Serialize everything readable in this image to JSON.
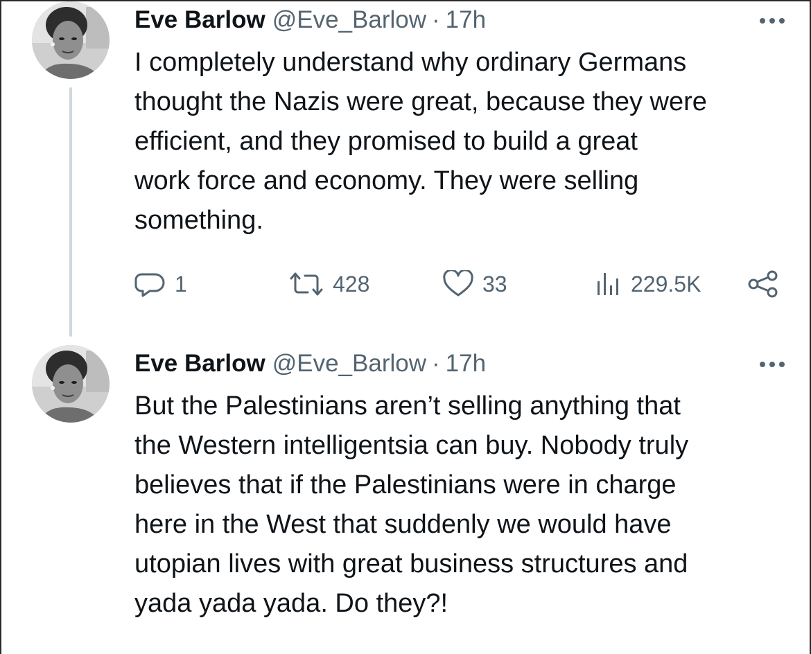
{
  "tweets": [
    {
      "author": {
        "name": "Eve Barlow",
        "handle": "@Eve_Barlow",
        "separator": "·",
        "time": "17h"
      },
      "lines": [
        "I completely understand why ordinary Germans",
        "thought the Nazis were great, because they were",
        "efficient, and they promised to build a great",
        "work force and economy. They were selling",
        "something."
      ],
      "actions": {
        "replies": "1",
        "reposts": "428",
        "likes": "33",
        "views": "229.5K"
      }
    },
    {
      "author": {
        "name": "Eve Barlow",
        "handle": "@Eve_Barlow",
        "separator": "·",
        "time": "17h"
      },
      "lines": [
        "But the Palestinians aren’t selling anything that",
        "the Western intelligentsia can buy. Nobody truly",
        "believes that if the Palestinians were in charge",
        "here in the West that suddenly we would have",
        "utopian lives with great business structures and",
        "yada yada yada. Do they?!"
      ]
    }
  ],
  "colors": {
    "text": "#0f1419",
    "secondary": "#536471",
    "thread_line": "#cfd9de"
  },
  "icons": [
    "reply-icon",
    "repost-icon",
    "like-icon",
    "views-icon",
    "share-icon",
    "more-icon"
  ]
}
